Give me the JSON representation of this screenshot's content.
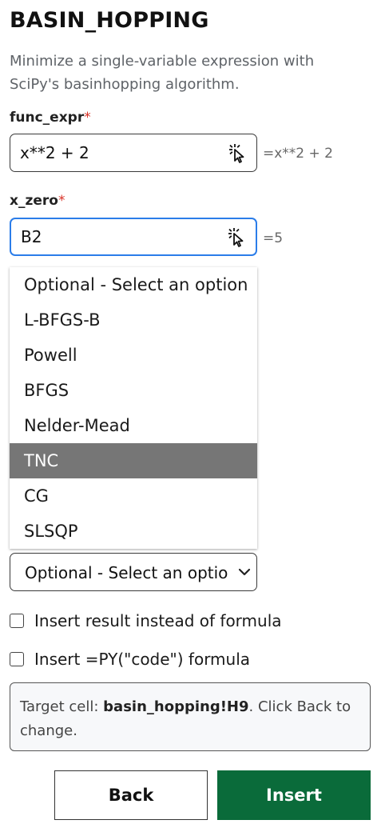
{
  "header": {
    "title": "BASIN_HOPPING",
    "description": "Minimize a single-variable expression with SciPy's basinhopping algorithm."
  },
  "fields": {
    "func_expr": {
      "label": "func_expr",
      "required_mark": "*",
      "value": "x**2 + 2",
      "preview": "=x**2 + 2"
    },
    "x_zero": {
      "label": "x_zero",
      "required_mark": "*",
      "value": "B2",
      "preview": "=5"
    }
  },
  "method_dropdown": {
    "options": [
      "Optional - Select an option",
      "L-BFGS-B",
      "Powell",
      "BFGS",
      "Nelder-Mead",
      "TNC",
      "CG",
      "SLSQP"
    ],
    "highlighted": "TNC",
    "selected_display": "Optional - Select an option"
  },
  "checkboxes": {
    "insert_result": {
      "label": "Insert result instead of formula",
      "checked": false
    },
    "insert_py": {
      "label": "Insert =PY(\"code\") formula",
      "checked": false
    }
  },
  "target": {
    "prefix": "Target cell: ",
    "cell": "basin_hopping!H9",
    "suffix": ". Click Back to change."
  },
  "buttons": {
    "back": "Back",
    "insert": "Insert"
  },
  "colors": {
    "accent_focus": "#2b7de9",
    "insert_bg": "#0a6b3a",
    "required": "#d93025",
    "highlight": "#767676"
  },
  "icons": {
    "pick": "cursor-pick-icon",
    "chevron": "chevron-down-icon"
  }
}
